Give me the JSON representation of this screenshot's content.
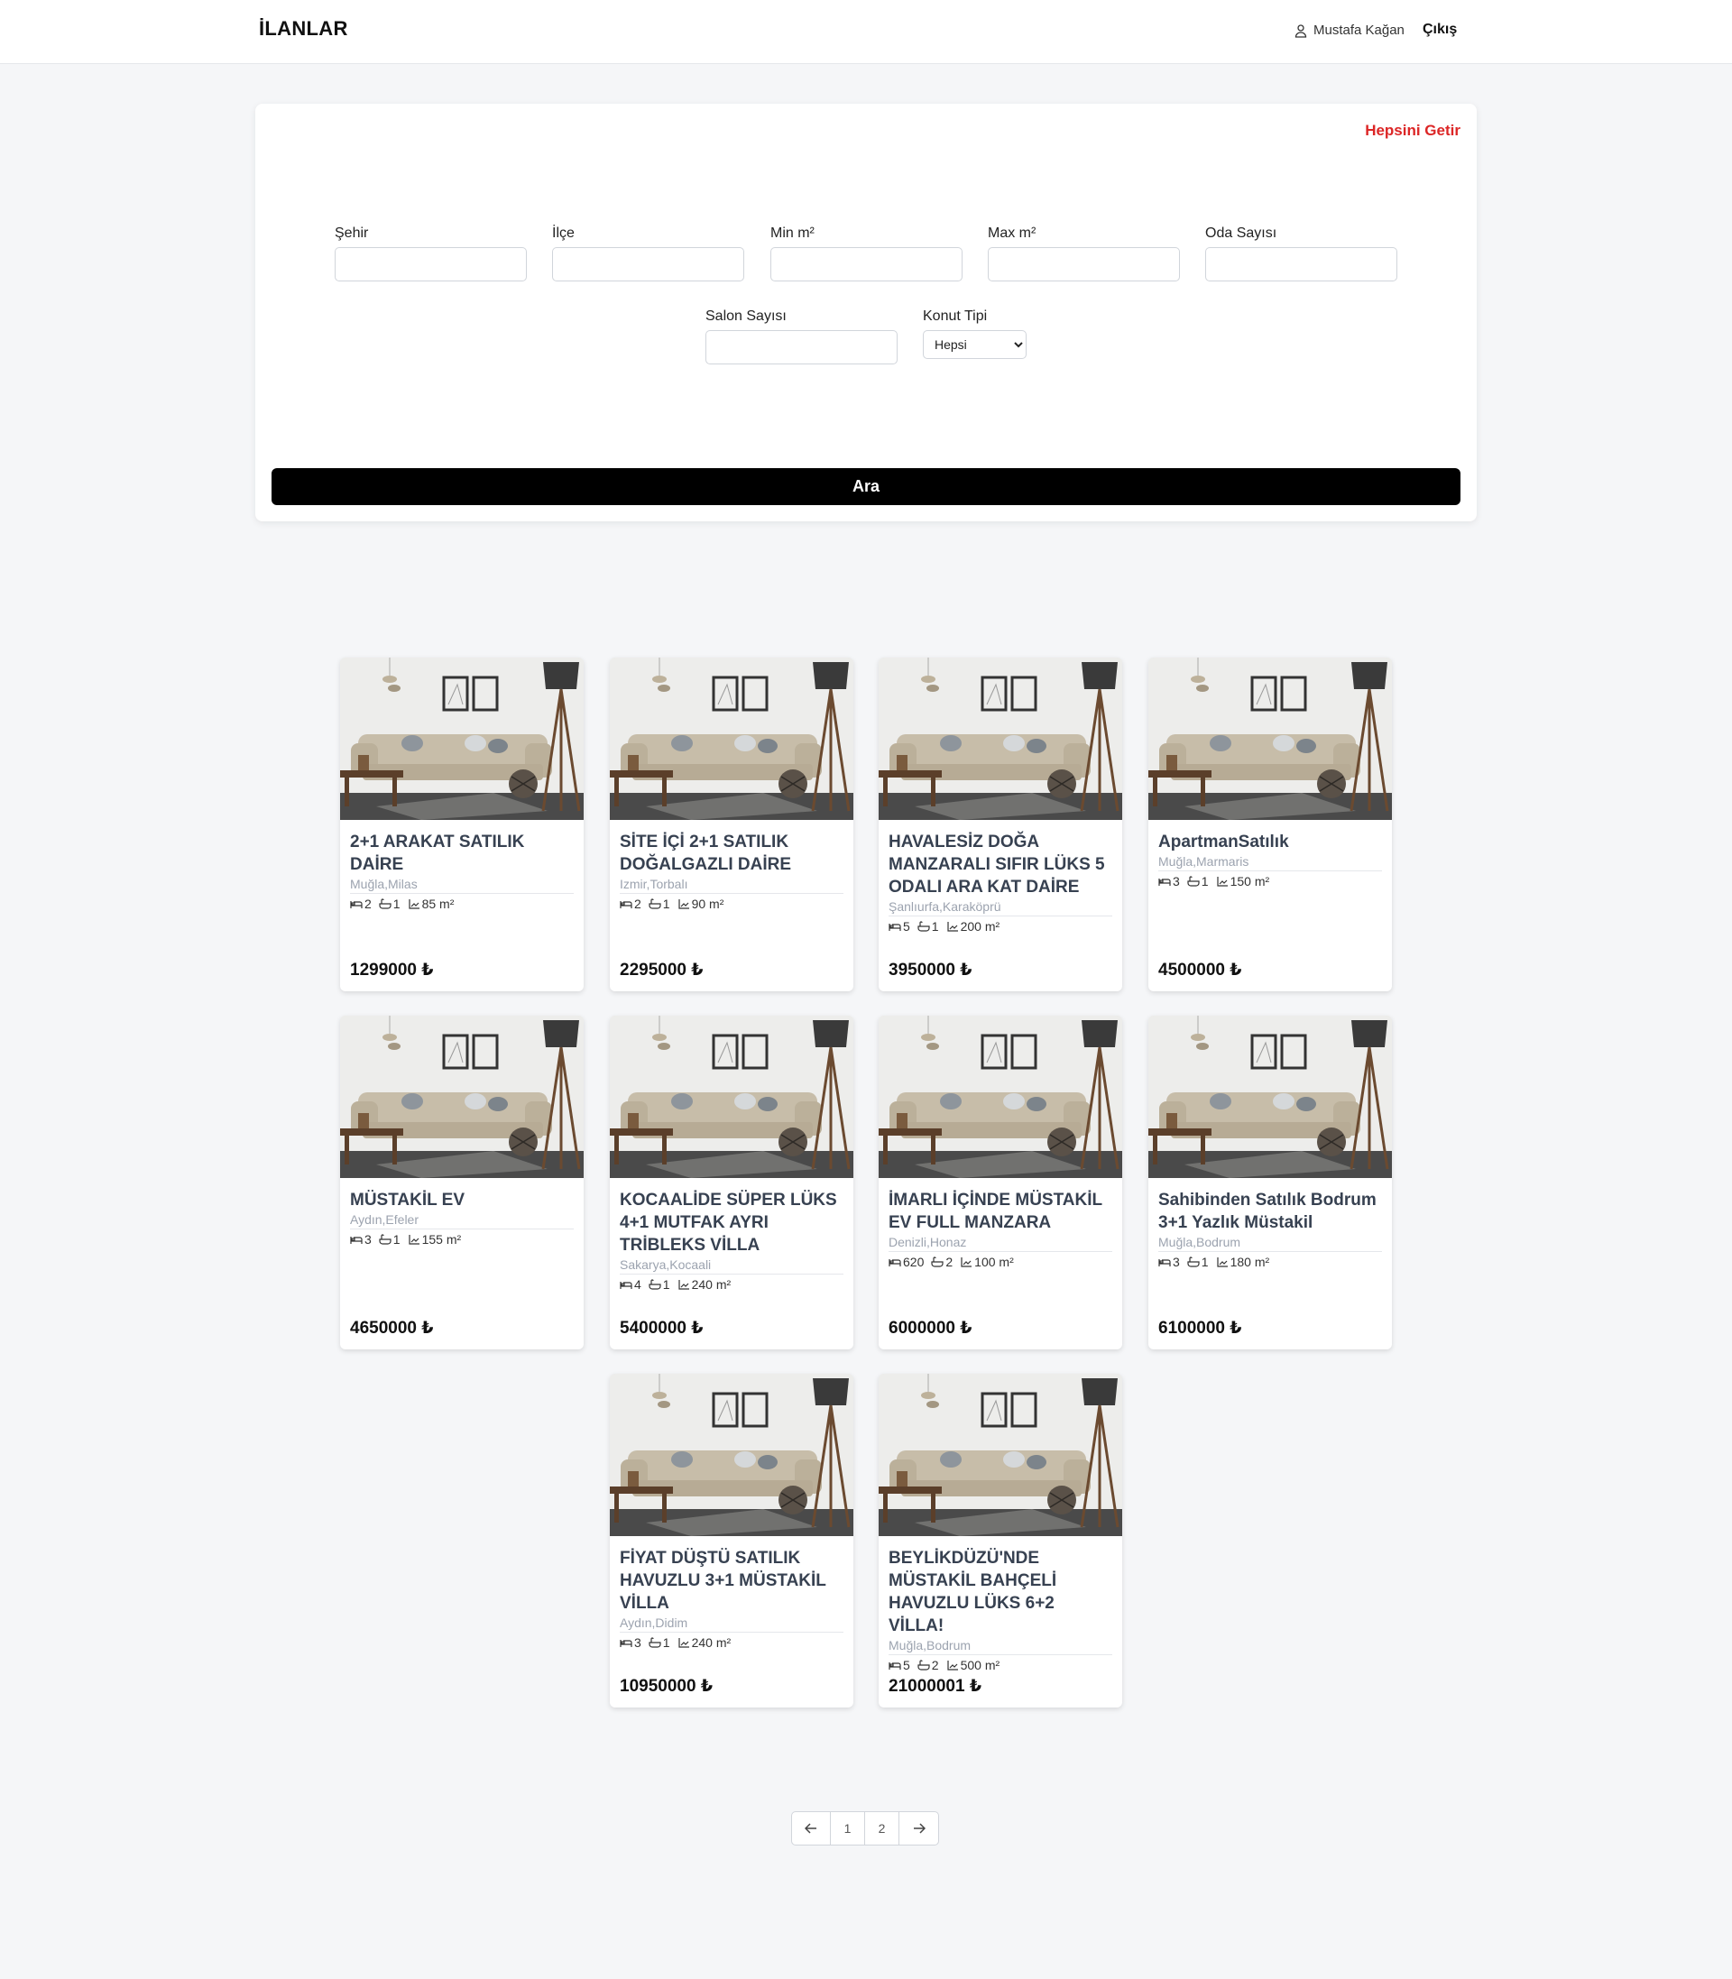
{
  "header": {
    "brand": "İLANLAR",
    "user_name": "Mustafa Kağan",
    "logout_label": "Çıkış"
  },
  "search": {
    "reset_label": "Hepsini Getir",
    "fields": {
      "city": {
        "label": "Şehir",
        "value": ""
      },
      "district": {
        "label": "İlçe",
        "value": ""
      },
      "min_m2": {
        "label": "Min m²",
        "value": ""
      },
      "max_m2": {
        "label": "Max m²",
        "value": ""
      },
      "rooms": {
        "label": "Oda Sayısı",
        "value": ""
      },
      "salons": {
        "label": "Salon Sayısı",
        "value": ""
      },
      "type": {
        "label": "Konut Tipi",
        "selected": "Hepsi"
      }
    },
    "submit_label": "Ara"
  },
  "listings": [
    {
      "title": "2+1 ARAKAT SATILIK DAİRE",
      "location": "Muğla,Milas",
      "beds": "2",
      "baths": "1",
      "area": "85 m²",
      "price": "1299000 ₺"
    },
    {
      "title": "SİTE İÇİ 2+1 SATILIK DOĞALGAZLI DAİRE",
      "location": "Izmir,Torbalı",
      "beds": "2",
      "baths": "1",
      "area": "90 m²",
      "price": "2295000 ₺"
    },
    {
      "title": "HAVALESİZ DOĞA MANZARALI SIFIR LÜKS 5 ODALI ARA KAT DAİRE",
      "location": "Şanlıurfa,Karaköprü",
      "beds": "5",
      "baths": "1",
      "area": "200 m²",
      "price": "3950000 ₺"
    },
    {
      "title": "ApartmanSatılık",
      "location": "Muğla,Marmaris",
      "beds": "3",
      "baths": "1",
      "area": "150 m²",
      "price": "4500000 ₺"
    },
    {
      "title": "MÜSTAKİL EV",
      "location": "Aydın,Efeler",
      "beds": "3",
      "baths": "1",
      "area": "155 m²",
      "price": "4650000 ₺"
    },
    {
      "title": "KOCAALİDE SÜPER LÜKS 4+1 MUTFAK AYRI TRİBLEKS VİLLA",
      "location": "Sakarya,Kocaali",
      "beds": "4",
      "baths": "1",
      "area": "240 m²",
      "price": "5400000 ₺"
    },
    {
      "title": "İMARLI İÇİNDE MÜSTAKİL EV FULL MANZARA",
      "location": "Denizli,Honaz",
      "beds": "620",
      "baths": "2",
      "area": "100 m²",
      "price": "6000000 ₺"
    },
    {
      "title": "Sahibinden Satılık Bodrum 3+1 Yazlık Müstakil",
      "location": "Muğla,Bodrum",
      "beds": "3",
      "baths": "1",
      "area": "180 m²",
      "price": "6100000 ₺"
    },
    {
      "title": "FİYAT DÜŞTÜ SATILIK HAVUZLU 3+1 MÜSTAKİL VİLLA",
      "location": "Aydın,Didim",
      "beds": "3",
      "baths": "1",
      "area": "240 m²",
      "price": "10950000 ₺"
    },
    {
      "title": "BEYLİKDÜZÜ'NDE MÜSTAKİL BAHÇELİ HAVUZLU LÜKS 6+2 VİLLA!",
      "location": "Muğla,Bodrum",
      "beds": "5",
      "baths": "2",
      "area": "500 m²",
      "price": "21000001 ₺"
    }
  ],
  "pagination": {
    "prev_icon": "arrow-left-icon",
    "pages": [
      "1",
      "2"
    ],
    "next_icon": "arrow-right-icon"
  }
}
